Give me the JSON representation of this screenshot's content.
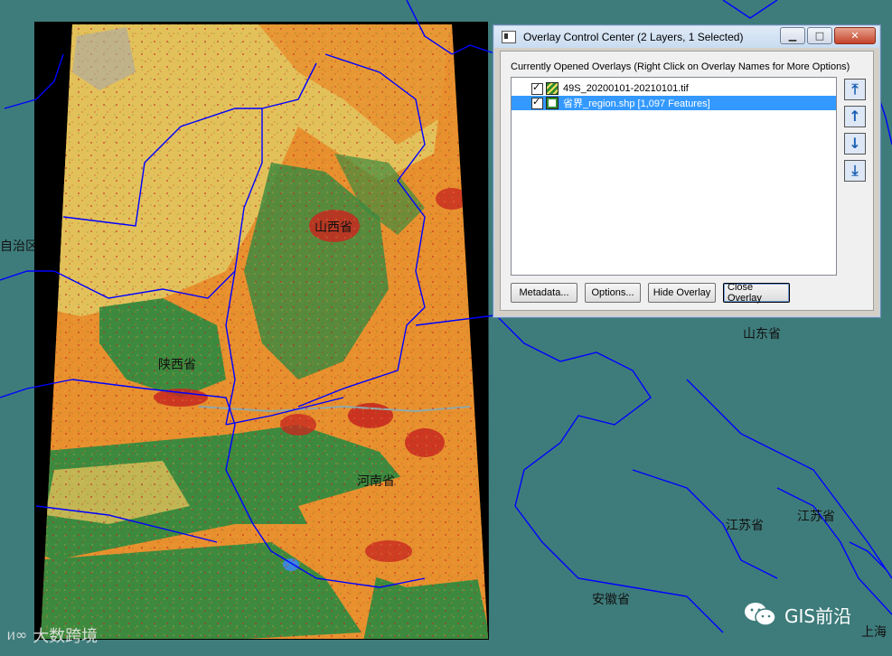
{
  "dialog": {
    "title": "Overlay Control Center (2 Layers, 1 Selected)",
    "caption": "Currently Opened Overlays (Right Click on Overlay Names for More Options)",
    "overlays": [
      {
        "name": "49S_20200101-20210101.tif",
        "checked": true,
        "selected": false,
        "icon": "raster-layer-icon"
      },
      {
        "name": "省界_region.shp [1,097 Features]",
        "checked": true,
        "selected": true,
        "icon": "vector-layer-icon"
      }
    ],
    "buttons": {
      "metadata": "Metadata...",
      "options": "Options...",
      "hide": "Hide Overlay",
      "close": "Close Overlay"
    },
    "window_buttons": {
      "minimize": "▁",
      "maximize": "□",
      "close": "✕"
    },
    "arrow_buttons": [
      "move-to-top-icon",
      "move-up-icon",
      "move-down-icon",
      "move-to-bottom-icon"
    ]
  },
  "map": {
    "labels": {
      "shanxi": "山西省",
      "shaanxi": "陕西省",
      "henan": "河南省",
      "shandong": "山东省",
      "jiangsu1": "江苏省",
      "jiangsu2": "江苏省",
      "anhui": "安徽省",
      "shanghai": "上海",
      "zizhiqu": "自治区"
    },
    "colors": {
      "background": "#3e7c7b",
      "boundary": "#0000ff",
      "cropland": "#e8902e",
      "grassland": "#e3c15a",
      "forest": "#3d8a3e",
      "urban": "#c8281f",
      "water": "#3e88d8",
      "nodata": "#000000"
    }
  },
  "watermarks": {
    "left": "大数跨境",
    "right": "GIS前沿"
  }
}
